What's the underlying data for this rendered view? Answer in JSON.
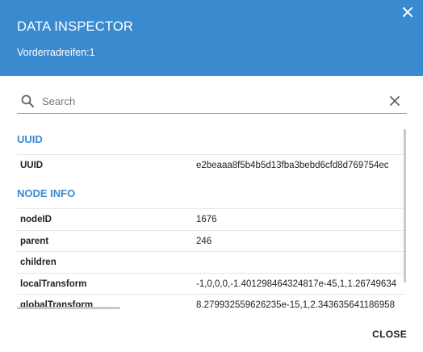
{
  "header": {
    "title": "DATA INSPECTOR",
    "subtitle": "Vorderradreifen:1",
    "close_icon": "close-icon"
  },
  "search": {
    "placeholder": "Search",
    "value": "",
    "search_icon": "search-icon",
    "clear_icon": "clear-icon"
  },
  "sections": [
    {
      "title": "UUID",
      "rows": [
        {
          "key": "UUID",
          "value": "e2beaaa8f5b4b5d13fba3bebd6cfd8d769754ec"
        }
      ]
    },
    {
      "title": "NODE INFO",
      "rows": [
        {
          "key": "nodeID",
          "value": "1676"
        },
        {
          "key": "parent",
          "value": "246"
        },
        {
          "key": "children",
          "value": ""
        },
        {
          "key": "localTransform",
          "value": "-1,0,0,0,-1.401298464324817e-45,1,1.26749634"
        },
        {
          "key": "globalTransform",
          "value": "8.279932559626235e-15,1,2.343635641186958"
        }
      ]
    }
  ],
  "footer": {
    "close_label": "CLOSE"
  },
  "colors": {
    "header_bg": "#3a8ad0",
    "section_title": "#3a8ad0"
  }
}
